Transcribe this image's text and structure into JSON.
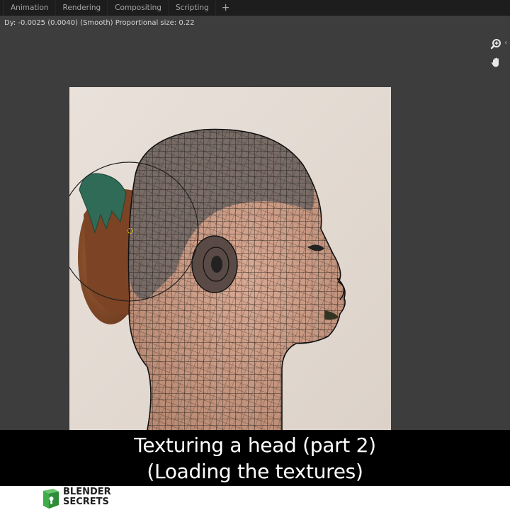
{
  "topbar": {
    "tabs": [
      {
        "label": "Animation"
      },
      {
        "label": "Rendering"
      },
      {
        "label": "Compositing"
      },
      {
        "label": "Scripting"
      }
    ],
    "add_tab_label": "+"
  },
  "viewport": {
    "status": "Dy: -0.0025 (0.0040) (Smooth) Proportional size: 0.22"
  },
  "caption": {
    "line1": "Texturing a head (part 2)",
    "line2": "(Loading the textures)"
  },
  "brand": {
    "line1": "BLENDER",
    "line2": "SECRETS",
    "accent_color": "#3fae49"
  },
  "icons": {
    "zoom": "zoom-in-icon",
    "pan": "hand-pan-icon"
  }
}
